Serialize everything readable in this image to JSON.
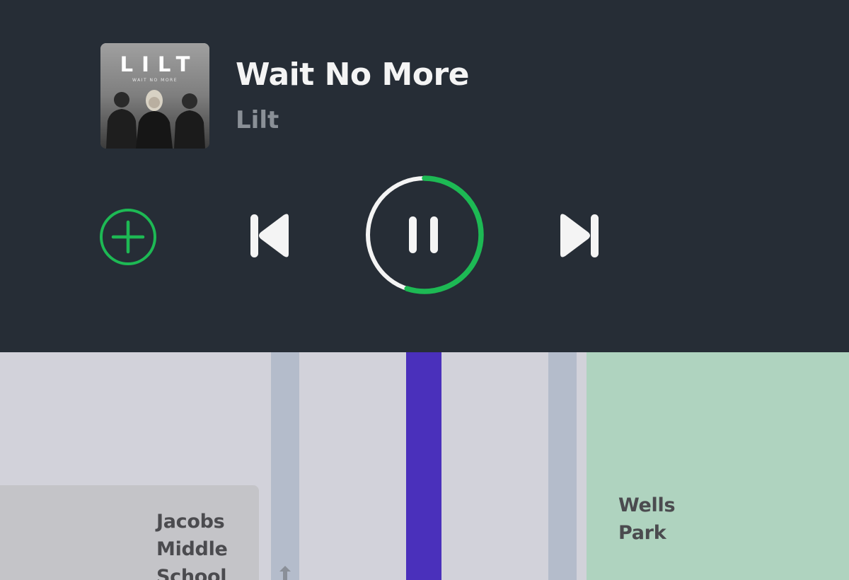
{
  "now_playing": {
    "title": "Wait No More",
    "artist": "Lilt",
    "album_art": {
      "band_text": "LILT",
      "subtitle_text": "WAIT NO MORE"
    },
    "progress_fraction": 0.55,
    "state": "playing"
  },
  "controls": {
    "add_icon": "plus-circle-icon",
    "prev_icon": "skip-previous-icon",
    "play_pause_icon": "pause-icon",
    "next_icon": "skip-next-icon"
  },
  "map": {
    "labels": {
      "school": "Jacobs Middle School",
      "park": "Wells Park"
    },
    "street_arrow_icon": "arrow-up-icon"
  },
  "colors": {
    "panel_bg": "#262d36",
    "accent_green": "#1db954",
    "icon_white": "#f4f4f4",
    "artist_grey": "#8a9097",
    "route_purple": "#4a30bb",
    "park_green": "#afd3bf",
    "map_bg": "#d2d2da",
    "street": "#b4bccb",
    "school_block": "#c4c4c8"
  }
}
